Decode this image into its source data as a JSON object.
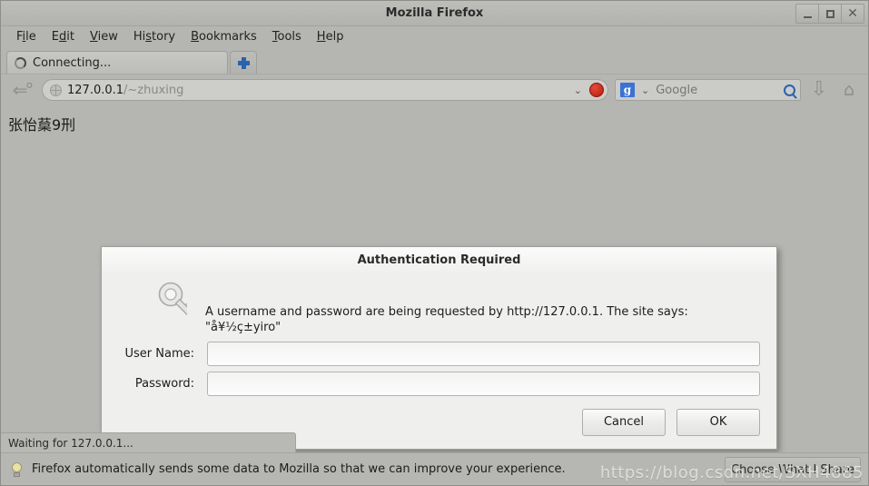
{
  "window": {
    "title": "Mozilla Firefox",
    "controls": {
      "minimize": "–",
      "maximize": "□",
      "close": "✕"
    }
  },
  "menubar": {
    "items": [
      {
        "pre": "F",
        "accel": "i",
        "post": "le"
      },
      {
        "pre": "E",
        "accel": "d",
        "post": "it"
      },
      {
        "pre": "",
        "accel": "V",
        "post": "iew"
      },
      {
        "pre": "Hi",
        "accel": "s",
        "post": "tory"
      },
      {
        "pre": "",
        "accel": "B",
        "post": "ookmarks"
      },
      {
        "pre": "",
        "accel": "T",
        "post": "ools"
      },
      {
        "pre": "",
        "accel": "H",
        "post": "elp"
      }
    ]
  },
  "tabs": {
    "active_label": "Connecting...",
    "new_tab_label": "+"
  },
  "navbar": {
    "back_forward_icon": "back-forward-arrow",
    "url_host": "127.0.0.1",
    "url_path": "/~zhuxing",
    "dropdown_icon": "⌄",
    "stop_icon": "stop-icon",
    "search_engine": "g",
    "search_placeholder": "Google",
    "search_icon": "magnifier-icon",
    "downloads_icon": "⇩",
    "home_icon": "⌂"
  },
  "page": {
    "text": "张怡葈9刑"
  },
  "dialog": {
    "title": "Authentication Required",
    "icon": "key-icon",
    "message": "A username and password are being requested by http://127.0.0.1. The site says: \"å¥½ç±yiro\"",
    "fields": [
      {
        "label": "User Name:",
        "value": "",
        "placeholder": ""
      },
      {
        "label": "Password:",
        "value": "",
        "placeholder": ""
      }
    ],
    "cancel_label": "Cancel",
    "ok_label": "OK"
  },
  "status": {
    "text": "Waiting for 127.0.0.1..."
  },
  "notification": {
    "icon": "lightbulb-icon",
    "text": "Firefox automatically sends some data to Mozilla so that we can improve your experience.",
    "button_label": "Choose What I Share"
  },
  "watermark": {
    "text": "https://blog.csdn.net/SXH4885"
  },
  "colors": {
    "chrome_bg": "#b5b5b2",
    "dialog_bg": "#efefee",
    "accent_blue": "#2b62ad",
    "stop_red": "#b81b0c"
  }
}
